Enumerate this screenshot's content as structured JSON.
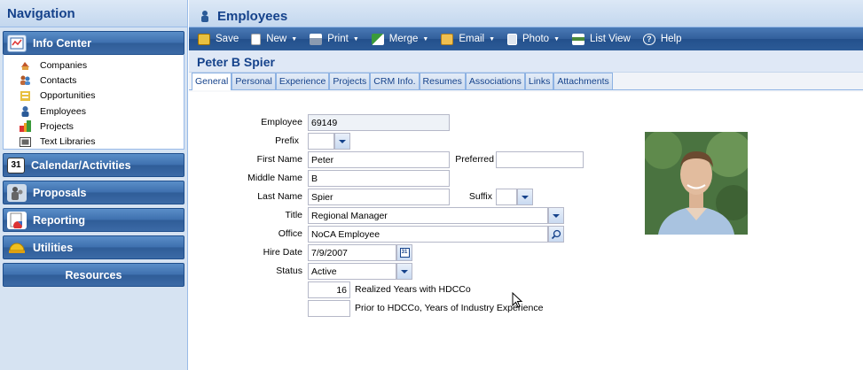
{
  "nav": {
    "title": "Navigation",
    "info_center": "Info Center",
    "items": [
      {
        "label": "Companies",
        "icon": "companies-icon"
      },
      {
        "label": "Contacts",
        "icon": "contacts-icon"
      },
      {
        "label": "Opportunities",
        "icon": "opportunities-icon"
      },
      {
        "label": "Employees",
        "icon": "employees-icon"
      },
      {
        "label": "Projects",
        "icon": "projects-icon"
      },
      {
        "label": "Text Libraries",
        "icon": "text-libraries-icon"
      }
    ],
    "calendar_badge": "31",
    "sections": {
      "calendar": "Calendar/Activities",
      "proposals": "Proposals",
      "reporting": "Reporting",
      "utilities": "Utilities",
      "resources": "Resources"
    }
  },
  "main": {
    "title": "Employees",
    "toolbar": {
      "save": "Save",
      "new": "New",
      "print": "Print",
      "merge": "Merge",
      "email": "Email",
      "photo": "Photo",
      "list_view": "List View",
      "help": "Help"
    },
    "record_title": "Peter B Spier",
    "tabs": [
      "General",
      "Personal",
      "Experience",
      "Projects",
      "CRM Info.",
      "Resumes",
      "Associations",
      "Links",
      "Attachments"
    ],
    "active_tab": "General"
  },
  "form": {
    "labels": {
      "employee": "Employee",
      "prefix": "Prefix",
      "first_name": "First Name",
      "preferred": "Preferred",
      "middle_name": "Middle Name",
      "last_name": "Last Name",
      "suffix": "Suffix",
      "title": "Title",
      "office": "Office",
      "hire_date": "Hire Date",
      "status": "Status",
      "realized_years": "Realized Years with HDCCo",
      "prior_years": "Prior to HDCCo, Years of Industry Experience"
    },
    "values": {
      "employee": "69149",
      "prefix": "",
      "first_name": "Peter",
      "preferred": "",
      "middle_name": "B",
      "last_name": "Spier",
      "suffix": "",
      "title": "Regional Manager",
      "office": "NoCA Employee",
      "hire_date": "7/9/2007",
      "status": "Active",
      "realized_years": "16",
      "prior_years": ""
    },
    "calendar_badge": "31"
  },
  "colors": {
    "nav_bg": "#d6e3f2",
    "section_blue": "#3d6fae",
    "toolbar_blue": "#2c5b97",
    "header_text": "#15428b"
  }
}
